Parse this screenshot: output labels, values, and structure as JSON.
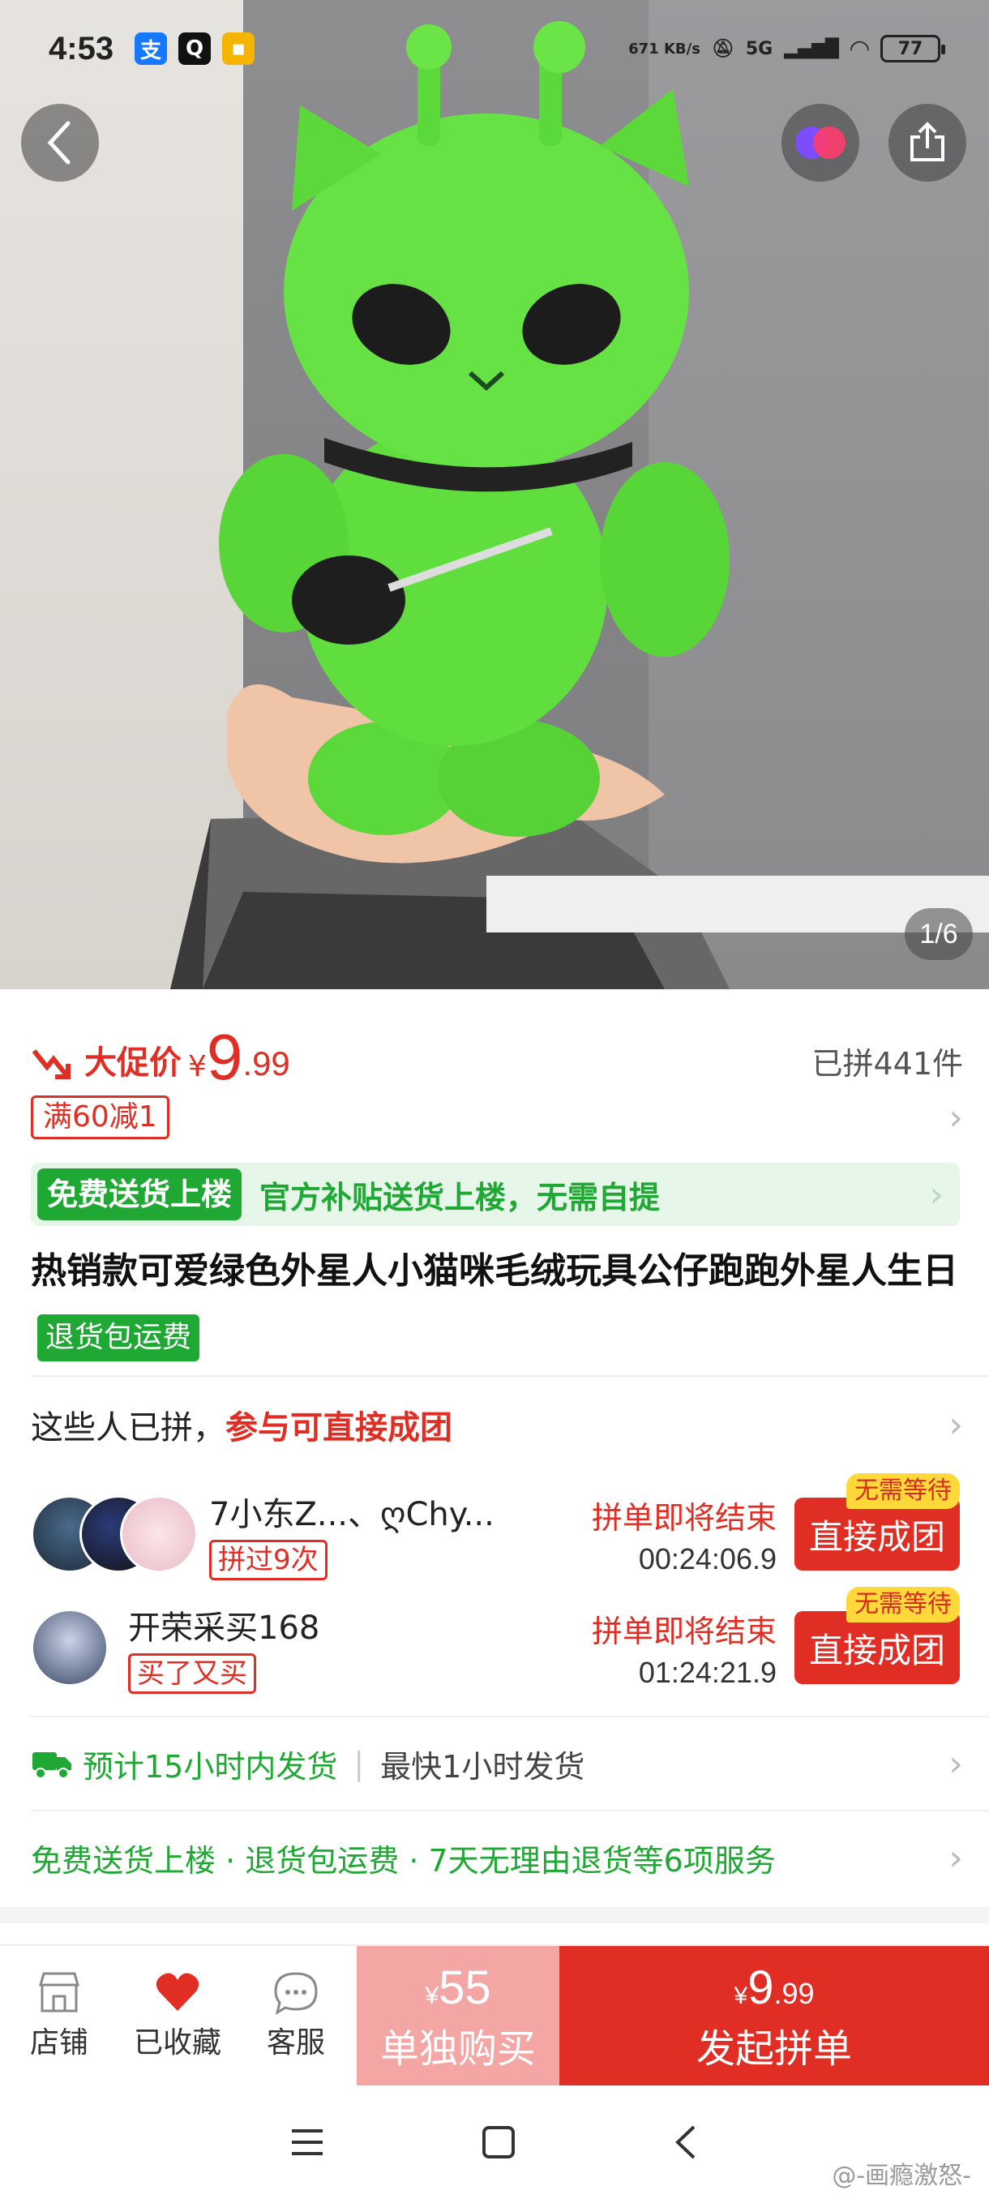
{
  "status_bar": {
    "time": "4:53",
    "speed": "671 KB/s",
    "network": "5G",
    "battery": "77"
  },
  "gallery": {
    "indicator": "1/6"
  },
  "price": {
    "promo_label": "大促价",
    "currency": "¥",
    "integer": "9",
    "decimal": ".99",
    "sold_count": "已拼441件"
  },
  "coupon": {
    "label": "满60减1"
  },
  "free_delivery": {
    "tag": "免费送货上楼",
    "text": "官方补贴送货上楼，无需自提"
  },
  "product": {
    "title": "热销款可爱绿色外星人小猫咪毛绒玩具公仔跑跑外星人生日",
    "return_tag": "退货包运费"
  },
  "group_buy": {
    "header_prefix": "这些人已拼，",
    "header_highlight": "参与可直接成团",
    "rows": [
      {
        "names": "7小东Z...、ღChy...",
        "badge": "拼过9次",
        "status": "拼单即将结束",
        "timer": "00:24:06.9",
        "button": "直接成团",
        "wait_tag": "无需等待"
      },
      {
        "names": "开荣采买168",
        "badge": "买了又买",
        "status": "拼单即将结束",
        "timer": "01:24:21.9",
        "button": "直接成团",
        "wait_tag": "无需等待"
      }
    ]
  },
  "shipping": {
    "estimate": "预计15小时内发货",
    "fastest": "最快1小时发货"
  },
  "services": {
    "text": "免费送货上楼 · 退货包运费 · 7天无理由退货等6项服务"
  },
  "bottom_bar": {
    "store": "店铺",
    "favorite": "已收藏",
    "service": "客服",
    "solo_currency": "¥",
    "solo_price": "55",
    "solo_label": "单独购买",
    "group_currency": "¥",
    "group_price_int": "9",
    "group_price_dec": ".99",
    "group_label": "发起拼单"
  },
  "watermark": "@-画瘾激怒-",
  "colors": {
    "accent_red": "#e02e24",
    "accent_green": "#1fa834",
    "solo_button": "#f3a6a3",
    "wait_tag": "#ffd93a"
  }
}
